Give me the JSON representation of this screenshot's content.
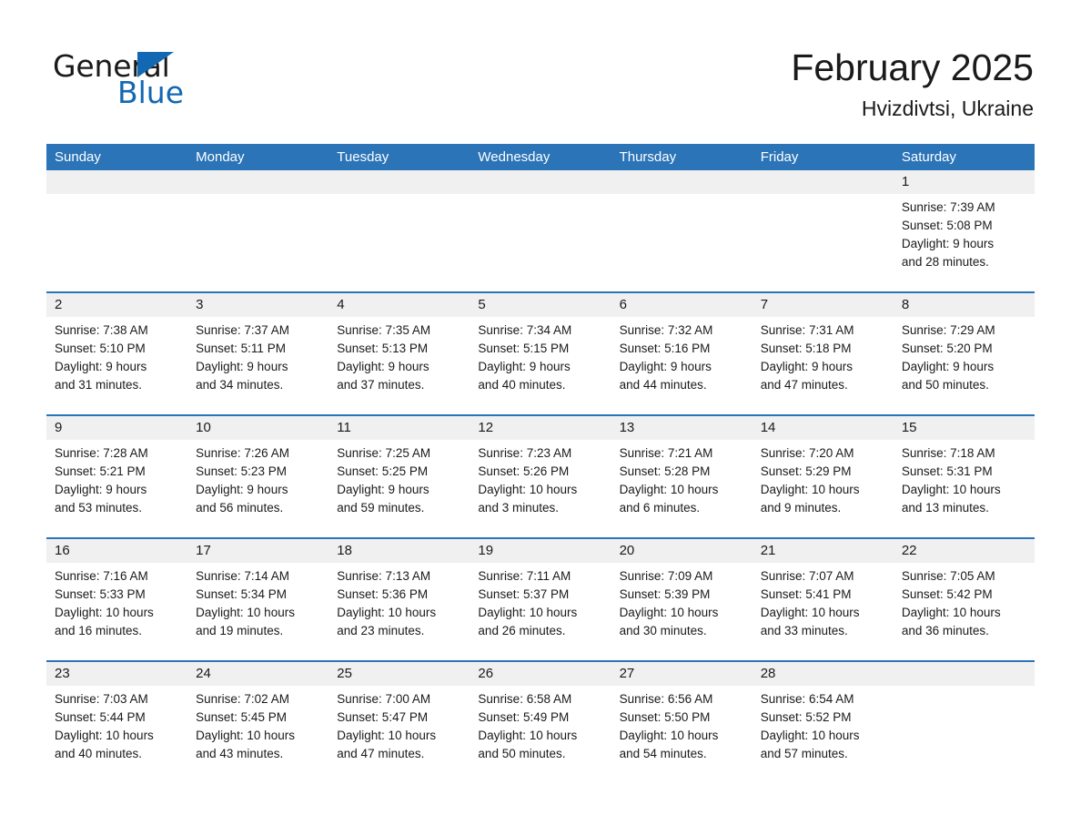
{
  "brand": {
    "name_part1": "General",
    "name_part2": "Blue",
    "accent_color": "#1268b3"
  },
  "header": {
    "month_title": "February 2025",
    "location": "Hvizdivtsi, Ukraine"
  },
  "calendar": {
    "header_color": "#2b74b8",
    "date_band_color": "#f0f0f0",
    "weekdays": [
      "Sunday",
      "Monday",
      "Tuesday",
      "Wednesday",
      "Thursday",
      "Friday",
      "Saturday"
    ],
    "weeks": [
      [
        {
          "date": "",
          "sunrise": "",
          "sunset": "",
          "daylight_line1": "",
          "daylight_line2": "",
          "empty": true
        },
        {
          "date": "",
          "sunrise": "",
          "sunset": "",
          "daylight_line1": "",
          "daylight_line2": "",
          "empty": true
        },
        {
          "date": "",
          "sunrise": "",
          "sunset": "",
          "daylight_line1": "",
          "daylight_line2": "",
          "empty": true
        },
        {
          "date": "",
          "sunrise": "",
          "sunset": "",
          "daylight_line1": "",
          "daylight_line2": "",
          "empty": true
        },
        {
          "date": "",
          "sunrise": "",
          "sunset": "",
          "daylight_line1": "",
          "daylight_line2": "",
          "empty": true
        },
        {
          "date": "",
          "sunrise": "",
          "sunset": "",
          "daylight_line1": "",
          "daylight_line2": "",
          "empty": true
        },
        {
          "date": "1",
          "sunrise": "Sunrise: 7:39 AM",
          "sunset": "Sunset: 5:08 PM",
          "daylight_line1": "Daylight: 9 hours",
          "daylight_line2": "and 28 minutes.",
          "empty": false
        }
      ],
      [
        {
          "date": "2",
          "sunrise": "Sunrise: 7:38 AM",
          "sunset": "Sunset: 5:10 PM",
          "daylight_line1": "Daylight: 9 hours",
          "daylight_line2": "and 31 minutes.",
          "empty": false
        },
        {
          "date": "3",
          "sunrise": "Sunrise: 7:37 AM",
          "sunset": "Sunset: 5:11 PM",
          "daylight_line1": "Daylight: 9 hours",
          "daylight_line2": "and 34 minutes.",
          "empty": false
        },
        {
          "date": "4",
          "sunrise": "Sunrise: 7:35 AM",
          "sunset": "Sunset: 5:13 PM",
          "daylight_line1": "Daylight: 9 hours",
          "daylight_line2": "and 37 minutes.",
          "empty": false
        },
        {
          "date": "5",
          "sunrise": "Sunrise: 7:34 AM",
          "sunset": "Sunset: 5:15 PM",
          "daylight_line1": "Daylight: 9 hours",
          "daylight_line2": "and 40 minutes.",
          "empty": false
        },
        {
          "date": "6",
          "sunrise": "Sunrise: 7:32 AM",
          "sunset": "Sunset: 5:16 PM",
          "daylight_line1": "Daylight: 9 hours",
          "daylight_line2": "and 44 minutes.",
          "empty": false
        },
        {
          "date": "7",
          "sunrise": "Sunrise: 7:31 AM",
          "sunset": "Sunset: 5:18 PM",
          "daylight_line1": "Daylight: 9 hours",
          "daylight_line2": "and 47 minutes.",
          "empty": false
        },
        {
          "date": "8",
          "sunrise": "Sunrise: 7:29 AM",
          "sunset": "Sunset: 5:20 PM",
          "daylight_line1": "Daylight: 9 hours",
          "daylight_line2": "and 50 minutes.",
          "empty": false
        }
      ],
      [
        {
          "date": "9",
          "sunrise": "Sunrise: 7:28 AM",
          "sunset": "Sunset: 5:21 PM",
          "daylight_line1": "Daylight: 9 hours",
          "daylight_line2": "and 53 minutes.",
          "empty": false
        },
        {
          "date": "10",
          "sunrise": "Sunrise: 7:26 AM",
          "sunset": "Sunset: 5:23 PM",
          "daylight_line1": "Daylight: 9 hours",
          "daylight_line2": "and 56 minutes.",
          "empty": false
        },
        {
          "date": "11",
          "sunrise": "Sunrise: 7:25 AM",
          "sunset": "Sunset: 5:25 PM",
          "daylight_line1": "Daylight: 9 hours",
          "daylight_line2": "and 59 minutes.",
          "empty": false
        },
        {
          "date": "12",
          "sunrise": "Sunrise: 7:23 AM",
          "sunset": "Sunset: 5:26 PM",
          "daylight_line1": "Daylight: 10 hours",
          "daylight_line2": "and 3 minutes.",
          "empty": false
        },
        {
          "date": "13",
          "sunrise": "Sunrise: 7:21 AM",
          "sunset": "Sunset: 5:28 PM",
          "daylight_line1": "Daylight: 10 hours",
          "daylight_line2": "and 6 minutes.",
          "empty": false
        },
        {
          "date": "14",
          "sunrise": "Sunrise: 7:20 AM",
          "sunset": "Sunset: 5:29 PM",
          "daylight_line1": "Daylight: 10 hours",
          "daylight_line2": "and 9 minutes.",
          "empty": false
        },
        {
          "date": "15",
          "sunrise": "Sunrise: 7:18 AM",
          "sunset": "Sunset: 5:31 PM",
          "daylight_line1": "Daylight: 10 hours",
          "daylight_line2": "and 13 minutes.",
          "empty": false
        }
      ],
      [
        {
          "date": "16",
          "sunrise": "Sunrise: 7:16 AM",
          "sunset": "Sunset: 5:33 PM",
          "daylight_line1": "Daylight: 10 hours",
          "daylight_line2": "and 16 minutes.",
          "empty": false
        },
        {
          "date": "17",
          "sunrise": "Sunrise: 7:14 AM",
          "sunset": "Sunset: 5:34 PM",
          "daylight_line1": "Daylight: 10 hours",
          "daylight_line2": "and 19 minutes.",
          "empty": false
        },
        {
          "date": "18",
          "sunrise": "Sunrise: 7:13 AM",
          "sunset": "Sunset: 5:36 PM",
          "daylight_line1": "Daylight: 10 hours",
          "daylight_line2": "and 23 minutes.",
          "empty": false
        },
        {
          "date": "19",
          "sunrise": "Sunrise: 7:11 AM",
          "sunset": "Sunset: 5:37 PM",
          "daylight_line1": "Daylight: 10 hours",
          "daylight_line2": "and 26 minutes.",
          "empty": false
        },
        {
          "date": "20",
          "sunrise": "Sunrise: 7:09 AM",
          "sunset": "Sunset: 5:39 PM",
          "daylight_line1": "Daylight: 10 hours",
          "daylight_line2": "and 30 minutes.",
          "empty": false
        },
        {
          "date": "21",
          "sunrise": "Sunrise: 7:07 AM",
          "sunset": "Sunset: 5:41 PM",
          "daylight_line1": "Daylight: 10 hours",
          "daylight_line2": "and 33 minutes.",
          "empty": false
        },
        {
          "date": "22",
          "sunrise": "Sunrise: 7:05 AM",
          "sunset": "Sunset: 5:42 PM",
          "daylight_line1": "Daylight: 10 hours",
          "daylight_line2": "and 36 minutes.",
          "empty": false
        }
      ],
      [
        {
          "date": "23",
          "sunrise": "Sunrise: 7:03 AM",
          "sunset": "Sunset: 5:44 PM",
          "daylight_line1": "Daylight: 10 hours",
          "daylight_line2": "and 40 minutes.",
          "empty": false
        },
        {
          "date": "24",
          "sunrise": "Sunrise: 7:02 AM",
          "sunset": "Sunset: 5:45 PM",
          "daylight_line1": "Daylight: 10 hours",
          "daylight_line2": "and 43 minutes.",
          "empty": false
        },
        {
          "date": "25",
          "sunrise": "Sunrise: 7:00 AM",
          "sunset": "Sunset: 5:47 PM",
          "daylight_line1": "Daylight: 10 hours",
          "daylight_line2": "and 47 minutes.",
          "empty": false
        },
        {
          "date": "26",
          "sunrise": "Sunrise: 6:58 AM",
          "sunset": "Sunset: 5:49 PM",
          "daylight_line1": "Daylight: 10 hours",
          "daylight_line2": "and 50 minutes.",
          "empty": false
        },
        {
          "date": "27",
          "sunrise": "Sunrise: 6:56 AM",
          "sunset": "Sunset: 5:50 PM",
          "daylight_line1": "Daylight: 10 hours",
          "daylight_line2": "and 54 minutes.",
          "empty": false
        },
        {
          "date": "28",
          "sunrise": "Sunrise: 6:54 AM",
          "sunset": "Sunset: 5:52 PM",
          "daylight_line1": "Daylight: 10 hours",
          "daylight_line2": "and 57 minutes.",
          "empty": false
        },
        {
          "date": "",
          "sunrise": "",
          "sunset": "",
          "daylight_line1": "",
          "daylight_line2": "",
          "empty": true
        }
      ]
    ]
  }
}
